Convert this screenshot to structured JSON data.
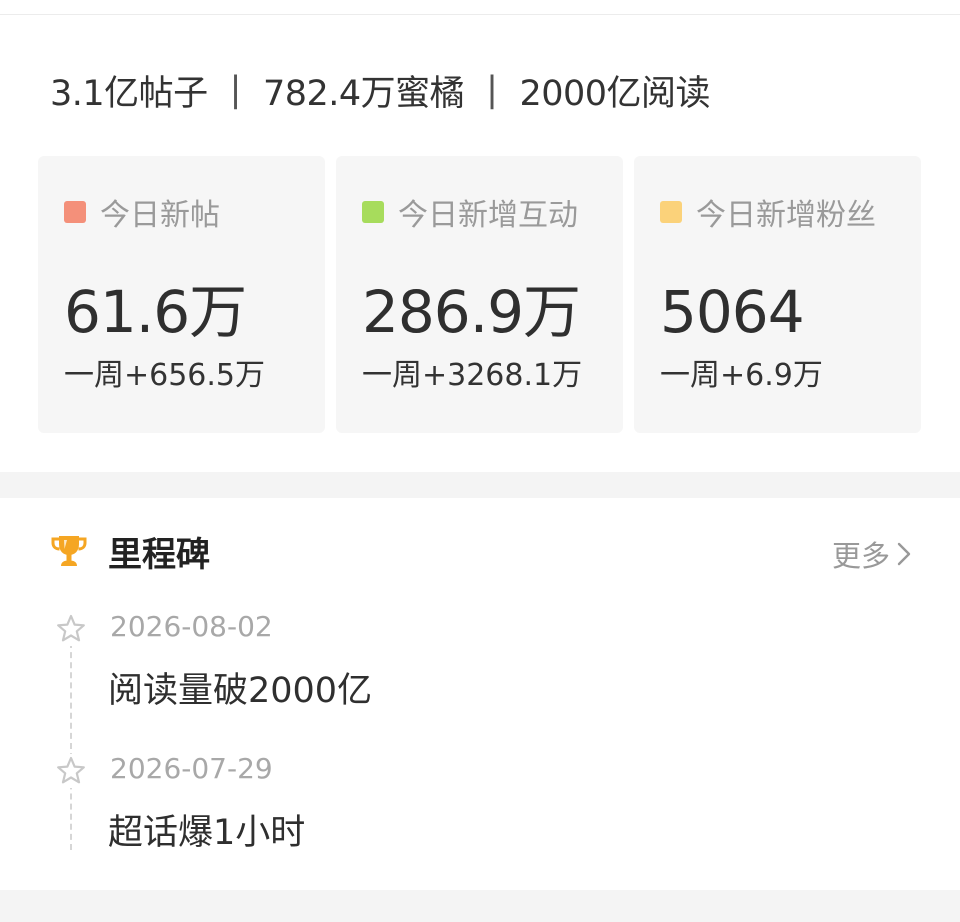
{
  "summary": {
    "posts": "3.1亿帖子",
    "members": "782.4万蜜橘",
    "reads": "2000亿阅读",
    "separator": "|"
  },
  "stats": [
    {
      "label": "今日新帖",
      "value": "61.6万",
      "delta": "一周+656.5万",
      "color": "#f4907a"
    },
    {
      "label": "今日新增互动",
      "value": "286.9万",
      "delta": "一周+3268.1万",
      "color": "#a7dc5c"
    },
    {
      "label": "今日新增粉丝",
      "value": "5064",
      "delta": "一周+6.9万",
      "color": "#fbd27a"
    }
  ],
  "milestones": {
    "icon": "trophy-icon",
    "title": "里程碑",
    "more_label": "更多",
    "accent": "#f5a623",
    "items": [
      {
        "date": "2026-08-02",
        "text": "阅读量破2000亿",
        "icon": "star-outline-icon"
      },
      {
        "date": "2026-07-29",
        "text": "超话爆1小时",
        "icon": "star-outline-icon"
      }
    ]
  }
}
